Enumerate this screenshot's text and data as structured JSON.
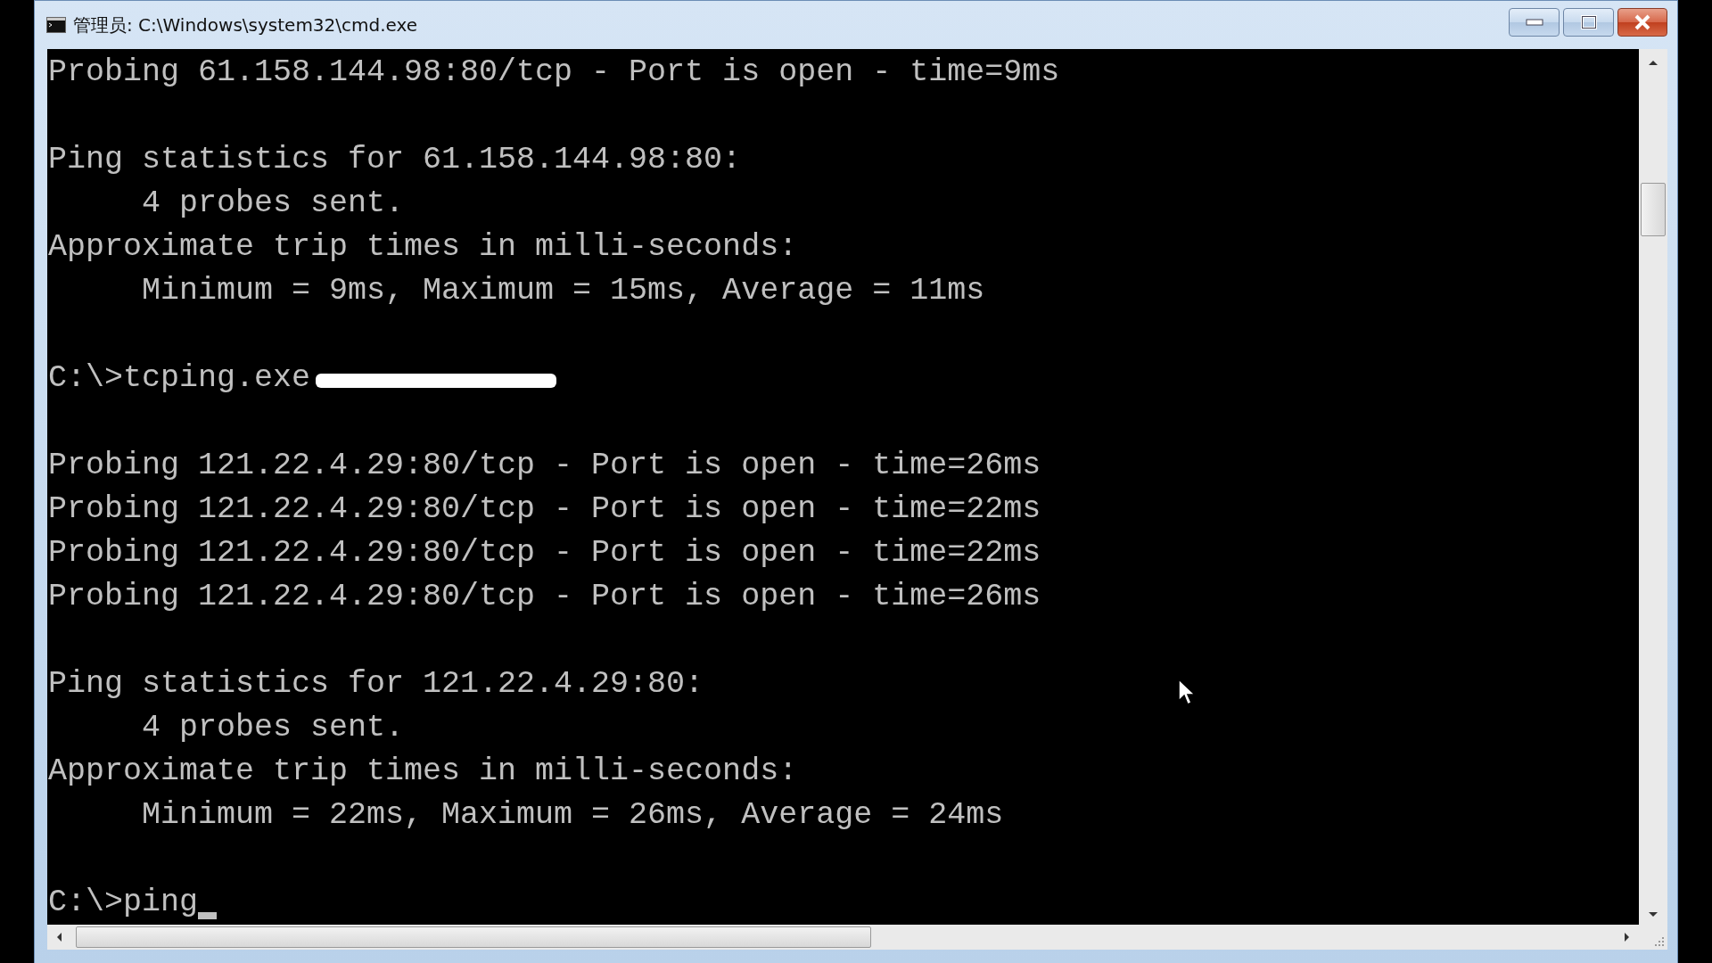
{
  "window": {
    "title": "管理员: C:\\Windows\\system32\\cmd.exe"
  },
  "console": {
    "lines": [
      {
        "kind": "output",
        "text": "Probing 61.158.144.98:80/tcp - Port is open - time=9ms"
      },
      {
        "kind": "blank"
      },
      {
        "kind": "output",
        "text": "Ping statistics for 61.158.144.98:80:"
      },
      {
        "kind": "output",
        "text": "     4 probes sent."
      },
      {
        "kind": "output",
        "text": "Approximate trip times in milli-seconds:"
      },
      {
        "kind": "output",
        "text": "     Minimum = 9ms, Maximum = 15ms, Average = 11ms"
      },
      {
        "kind": "blank"
      },
      {
        "kind": "redacted",
        "text": "C:\\>tcping.exe"
      },
      {
        "kind": "blank"
      },
      {
        "kind": "output",
        "text": "Probing 121.22.4.29:80/tcp - Port is open - time=26ms"
      },
      {
        "kind": "output",
        "text": "Probing 121.22.4.29:80/tcp - Port is open - time=22ms"
      },
      {
        "kind": "output",
        "text": "Probing 121.22.4.29:80/tcp - Port is open - time=22ms"
      },
      {
        "kind": "output",
        "text": "Probing 121.22.4.29:80/tcp - Port is open - time=26ms"
      },
      {
        "kind": "blank"
      },
      {
        "kind": "output",
        "text": "Ping statistics for 121.22.4.29:80:"
      },
      {
        "kind": "output",
        "text": "     4 probes sent."
      },
      {
        "kind": "output",
        "text": "Approximate trip times in milli-seconds:"
      },
      {
        "kind": "output",
        "text": "     Minimum = 22ms, Maximum = 26ms, Average = 24ms"
      },
      {
        "kind": "blank"
      },
      {
        "kind": "prompt",
        "text": "C:\\>ping"
      }
    ]
  }
}
